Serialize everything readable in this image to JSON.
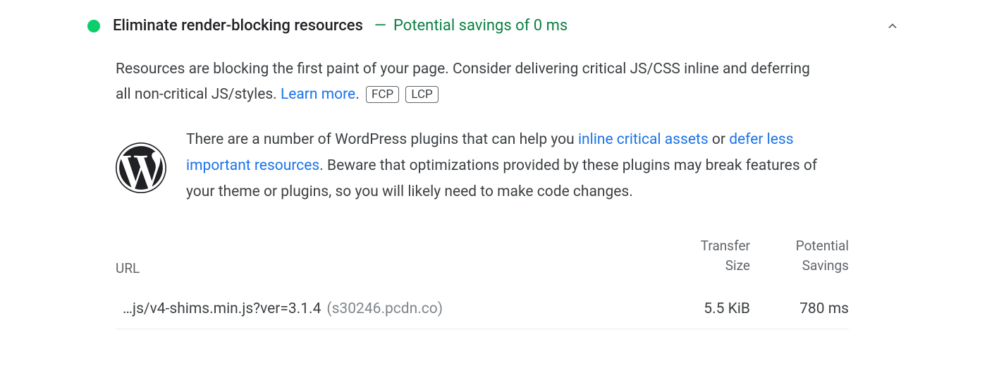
{
  "audit": {
    "title": "Eliminate render-blocking resources",
    "savings_sep": "—",
    "savings_text": "Potential savings of 0 ms",
    "description_pre": "Resources are blocking the first paint of your page. Consider delivering critical JS/CSS inline and deferring all non-critical JS/styles. ",
    "learn_more": "Learn more",
    "period": ".",
    "badge_fcp": "FCP",
    "badge_lcp": "LCP"
  },
  "stack_pack": {
    "pre": "There are a number of WordPress plugins that can help you ",
    "link_inline": "inline critical assets",
    "mid": " or ",
    "link_defer": "defer less important resources",
    "post": ". Beware that optimizations provided by these plugins may break features of your theme or plugins, so you will likely need to make code changes."
  },
  "table": {
    "headers": {
      "url": "URL",
      "transfer_l1": "Transfer",
      "transfer_l2": "Size",
      "savings_l1": "Potential",
      "savings_l2": "Savings"
    },
    "rows": [
      {
        "path": "…js/v4-shims.min.js?ver=3.1.4",
        "origin": "(s30246.pcdn.co)",
        "transfer": "5.5 KiB",
        "savings": "780 ms"
      }
    ]
  }
}
